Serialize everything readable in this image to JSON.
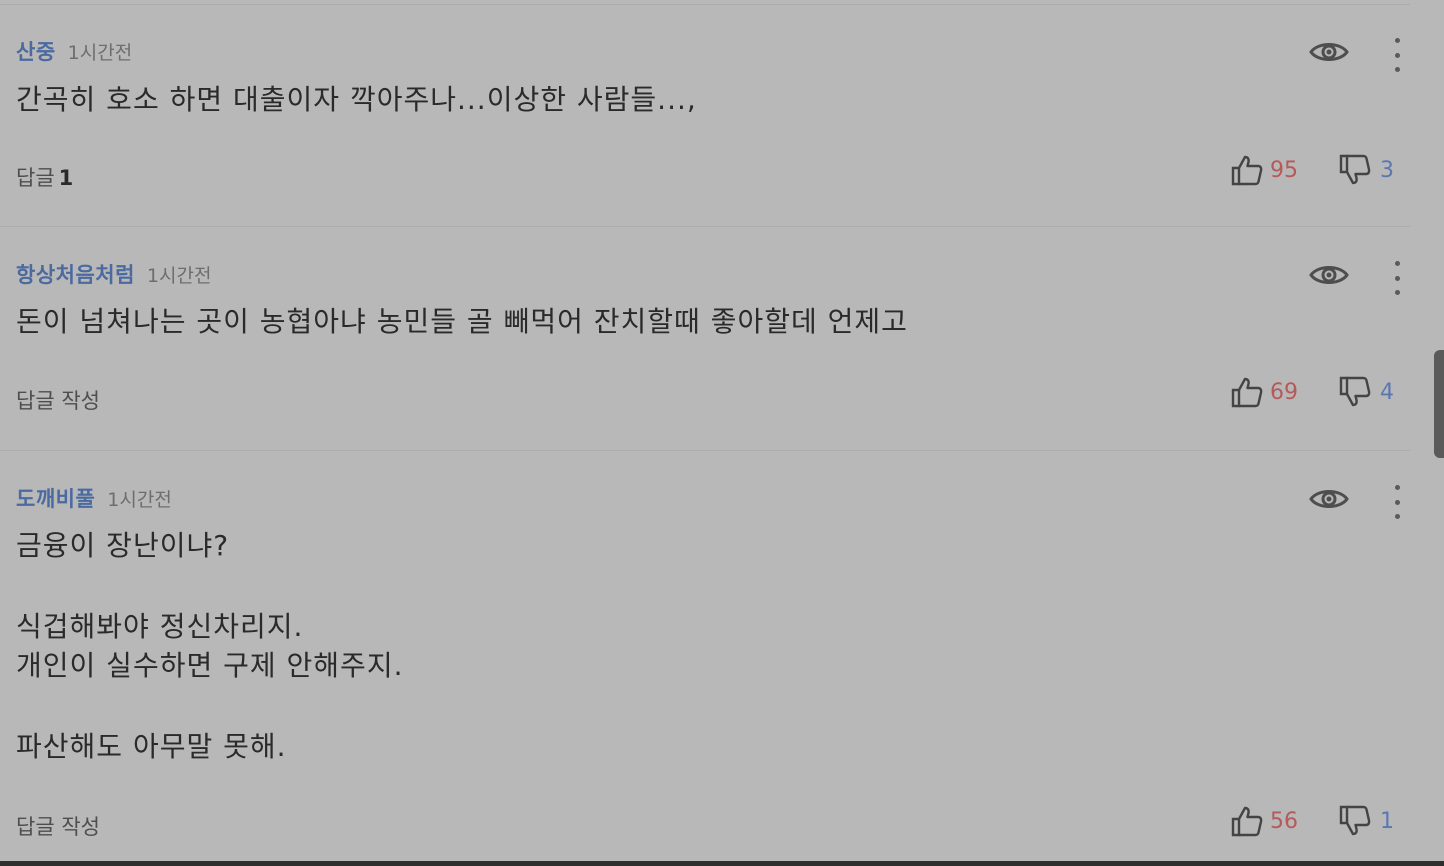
{
  "comments": [
    {
      "author": "산중",
      "time": "1시간전",
      "text": "간곡히 호소 하면 대출이자 깍아주나...이상한 사람들...,",
      "reply_label": "답글",
      "reply_count": "1",
      "likes": "95",
      "dislikes": "3"
    },
    {
      "author": "항상처음처럼",
      "time": "1시간전",
      "text": "돈이 넘쳐나는 곳이 농협아냐 농민들 골 빼먹어 잔치할때 좋아할데 언제고",
      "reply_label": "답글 작성",
      "likes": "69",
      "dislikes": "4"
    },
    {
      "author": "도깨비풀",
      "time": "1시간전",
      "text_lines": [
        "금융이 장난이냐?",
        "",
        "식겁해봐야 정신차리지.",
        "개인이 실수하면 구제 안해주지.",
        "",
        "파산해도 아무말 못해."
      ],
      "reply_label": "답글 작성",
      "likes": "56",
      "dislikes": "1"
    }
  ],
  "icons": {
    "view": "eye-icon",
    "more": "kebab-menu-icon",
    "like": "thumbs-up-icon",
    "dislike": "thumbs-down-icon"
  },
  "colors": {
    "background": "#b8b8b8",
    "author": "#4a6aa0",
    "like_count": "#b55a5a",
    "dislike_count": "#5a78b0"
  }
}
